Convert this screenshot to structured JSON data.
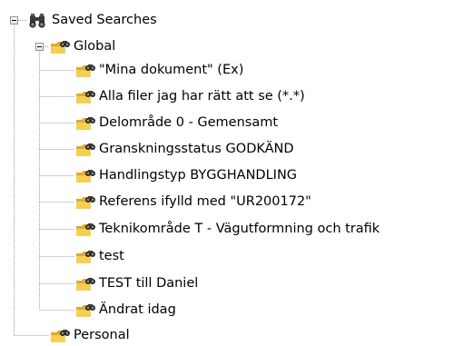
{
  "tree": {
    "root": {
      "label": "Saved Searches",
      "icon": "binoculars-icon",
      "expanded": true
    },
    "global": {
      "label": "Global",
      "icon": "folder-binoculars-icon",
      "expanded": true,
      "items": [
        {
          "label": "\"Mina dokument\" (Ex)",
          "icon": "folder-binoculars-icon"
        },
        {
          "label": "Alla filer jag har rätt att se (*.*)",
          "icon": "folder-binoculars-icon"
        },
        {
          "label": "Delområde 0 - Gemensamt",
          "icon": "folder-binoculars-icon"
        },
        {
          "label": "Granskningsstatus GODKÄND",
          "icon": "folder-binoculars-icon"
        },
        {
          "label": "Handlingstyp BYGGHANDLING",
          "icon": "folder-binoculars-icon"
        },
        {
          "label": "Referens ifylld med \"UR200172\"",
          "icon": "folder-binoculars-icon"
        },
        {
          "label": "Teknikområde T - Vägutformning och trafik",
          "icon": "folder-binoculars-icon"
        },
        {
          "label": "test",
          "icon": "folder-binoculars-icon"
        },
        {
          "label": "TEST till Daniel",
          "icon": "folder-binoculars-icon"
        },
        {
          "label": "Ändrat idag",
          "icon": "folder-binoculars-icon"
        }
      ]
    },
    "personal": {
      "label": "Personal",
      "icon": "folder-binoculars-icon"
    }
  },
  "colors": {
    "folder_yellow": "#f2c94c",
    "folder_dark": "#c9941f",
    "binocular": "#3a3a3a",
    "connector": "#a0a0a0"
  }
}
